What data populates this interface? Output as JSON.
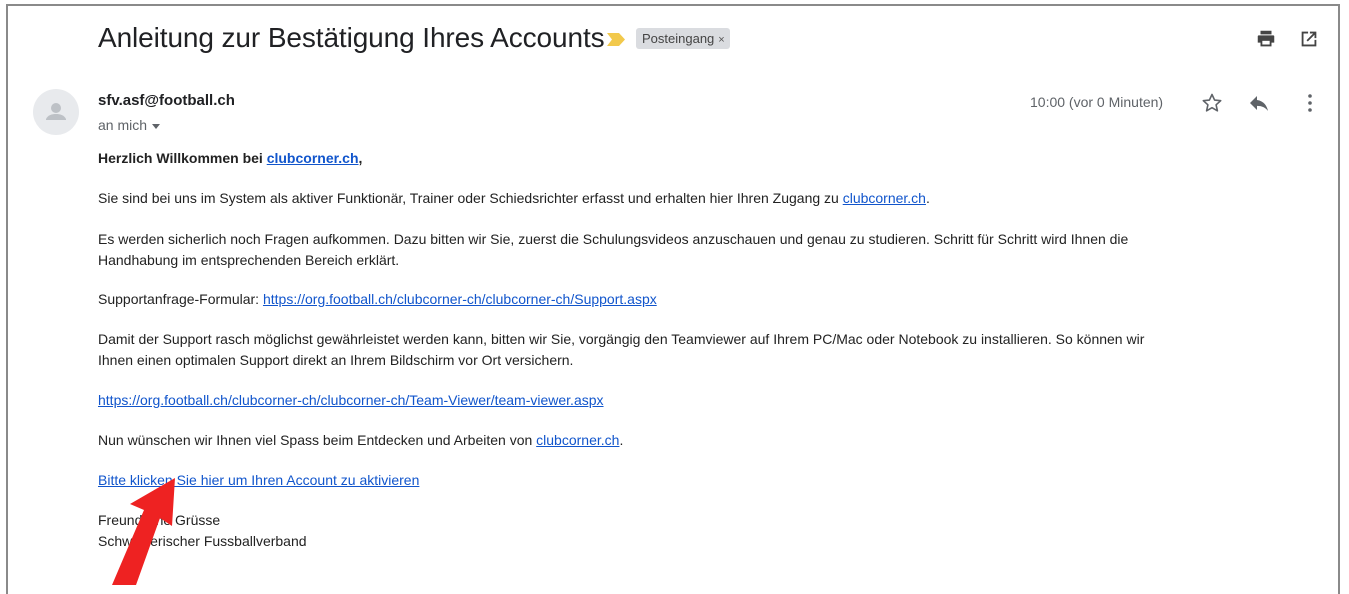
{
  "email": {
    "subject": "Anleitung zur Bestätigung Ihres Accounts",
    "label": "Posteingang",
    "label_remove": "×",
    "sender": "sfv.asf@football.ch",
    "recipient": "an mich",
    "timestamp": "10:00 (vor 0 Minuten)",
    "icons": {
      "importance": "importance-marker-icon",
      "print": "print-icon",
      "open_new_window": "open-in-new-window-icon",
      "star": "star-icon",
      "reply": "reply-icon",
      "more": "more-vertical-icon",
      "avatar": "person-avatar-icon"
    }
  },
  "body": {
    "greeting_prefix": "Herzlich Willkommen bei ",
    "greeting_link": "clubcorner.ch",
    "greeting_suffix": ",",
    "p1_text": "Sie sind bei uns im System als aktiver Funktionär, Trainer oder Schiedsrichter erfasst und erhalten hier Ihren Zugang zu ",
    "p1_link": "clubcorner.ch",
    "p1_suffix": ".",
    "p2_line1": "Es werden sicherlich noch Fragen aufkommen. Dazu bitten wir Sie, zuerst die Schulungsvideos anzuschauen und genau zu studieren. Schritt für Schritt wird Ihnen die",
    "p2_line2": "Handhabung im entsprechenden Bereich erklärt.",
    "p3_text": "Supportanfrage-Formular: ",
    "p3_link": "https://org.football.ch/clubcorner-ch/clubcorner-ch/Support.aspx",
    "p4_line1": "Damit der Support rasch möglichst gewährleistet werden kann, bitten wir Sie, vorgängig den Teamviewer auf Ihrem PC/Mac oder Notebook zu installieren. So können wir",
    "p4_line2": "Ihnen einen optimalen Support direkt an Ihrem Bildschirm vor Ort versichern.",
    "p5_link": "https://org.football.ch/clubcorner-ch/clubcorner-ch/Team-Viewer/team-viewer.aspx",
    "p6_text": "Nun wünschen wir Ihnen viel Spass beim Entdecken und Arbeiten von ",
    "p6_link": "clubcorner.ch",
    "p6_suffix": ".",
    "activate_link": "Bitte klicken Sie hier um Ihren Account zu aktivieren",
    "closing_line1": "Freundliche Grüsse",
    "closing_line2": "Schweizerischer Fussballverband"
  },
  "annotation": {
    "arrow_color": "#ee2222",
    "arrow_icon": "red-pointer-arrow"
  }
}
